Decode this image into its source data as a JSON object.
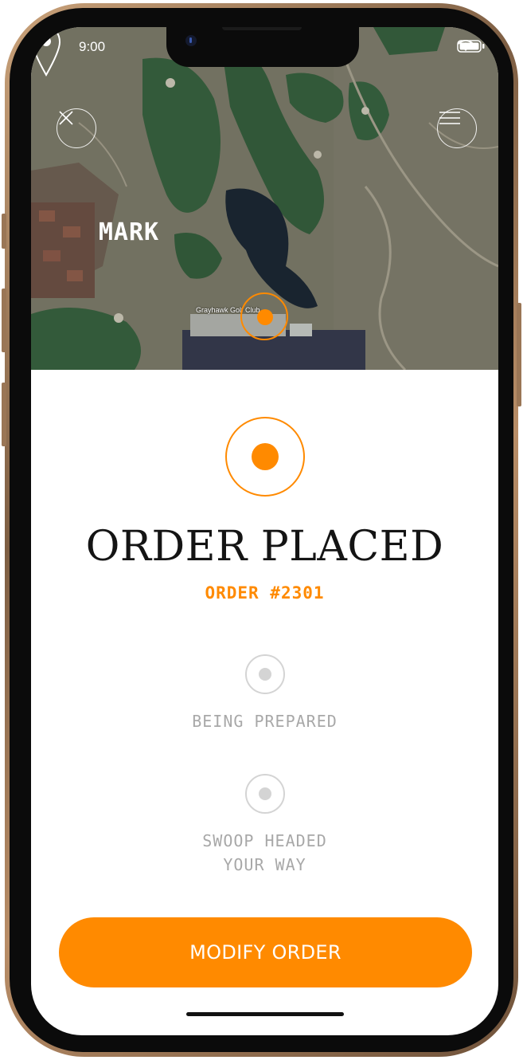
{
  "status_bar": {
    "time": "9:00"
  },
  "map": {
    "user_label": "MARK",
    "course_label": "Grayhawk Golf Club"
  },
  "order": {
    "status_title": "ORDER PLACED",
    "number": "ORDER #2301"
  },
  "steps": [
    {
      "label_lines": [
        "BEING PREPARED"
      ]
    },
    {
      "label_lines": [
        "SWOOP HEADED",
        "YOUR WAY"
      ]
    }
  ],
  "actions": {
    "modify_label": "MODIFY ORDER"
  },
  "colors": {
    "accent": "#ff8a00",
    "inactive": "#d4d4d4",
    "title": "#141414"
  },
  "icons": {
    "close": "close-icon",
    "menu": "hamburger-menu-icon",
    "pin": "map-pin-icon"
  }
}
